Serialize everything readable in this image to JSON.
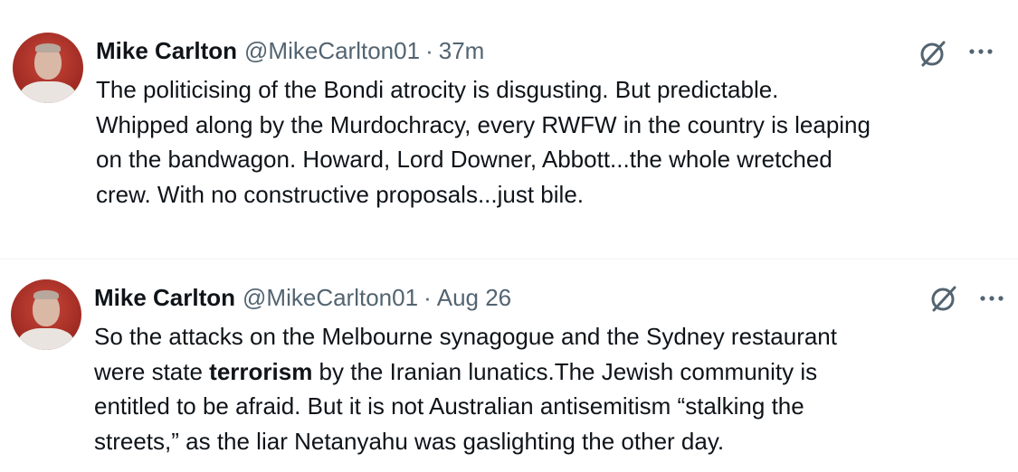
{
  "tweets": [
    {
      "author_name": "Mike Carlton",
      "handle": "@MikeCarlton01",
      "separator": "·",
      "time": "37m",
      "lines": [
        "The politicising of the Bondi atrocity is disgusting. But predictable.",
        "Whipped along by the Murdochracy, every RWFW in the country is leaping",
        "on the bandwagon. Howard, Lord Downer, Abbott...the whole wretched",
        "crew. With no constructive proposals...just bile."
      ]
    },
    {
      "author_name": "Mike Carlton",
      "handle": "@MikeCarlton01",
      "separator": "·",
      "time": "Aug 26",
      "line1": "So the attacks on the Melbourne synagogue and the Sydney  restaurant",
      "line2_before": "were state ",
      "line2_bold": "terrorism",
      "line2_after": " by the Iranian lunatics.The Jewish community is",
      "line3": "entitled to be afraid.  But it is not Australian antisemitism “stalking the",
      "line4": "streets,” as the liar Netanyahu was gaslighting the other day."
    }
  ],
  "icons": {
    "grok": "grok-icon",
    "more": "more-icon",
    "avatar": "avatar"
  },
  "colors": {
    "text": "#0f1419",
    "secondary": "#536471",
    "divider": "#eff3f4"
  }
}
